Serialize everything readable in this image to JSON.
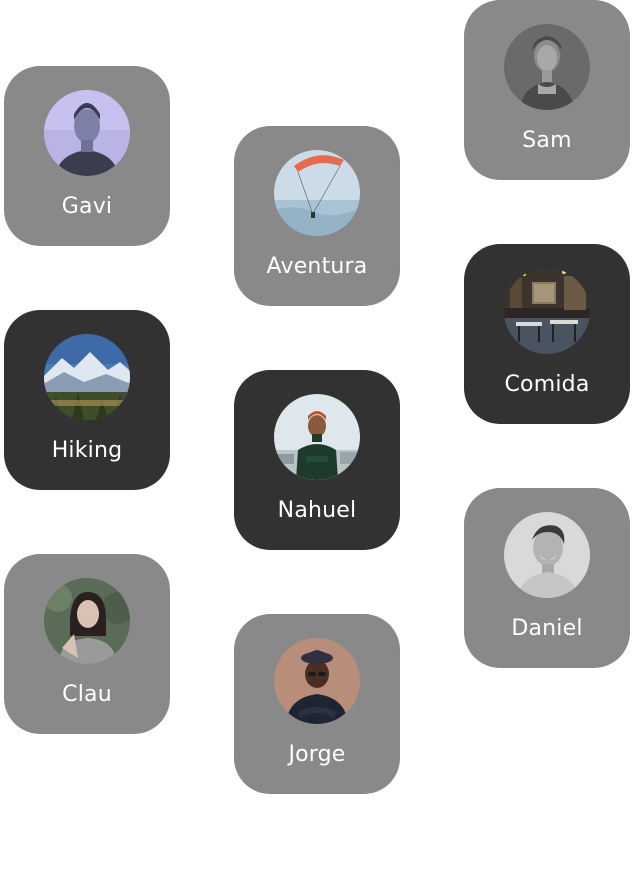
{
  "tiles": {
    "gavi": {
      "label": "Gavi",
      "avatar_icon": "person-portrait"
    },
    "hiking": {
      "label": "Hiking",
      "avatar_icon": "mountain-landscape"
    },
    "clau": {
      "label": "Clau",
      "avatar_icon": "person-portrait"
    },
    "aventura": {
      "label": "Aventura",
      "avatar_icon": "paraglider"
    },
    "nahuel": {
      "label": "Nahuel",
      "avatar_icon": "person-portrait"
    },
    "jorge": {
      "label": "Jorge",
      "avatar_icon": "person-portrait"
    },
    "sam": {
      "label": "Sam",
      "avatar_icon": "person-portrait"
    },
    "comida": {
      "label": "Comida",
      "avatar_icon": "restaurant-interior"
    },
    "daniel": {
      "label": "Daniel",
      "avatar_icon": "person-portrait"
    }
  },
  "colors": {
    "tile_light": "#898989",
    "tile_dark": "#323232",
    "label": "#ffffff"
  }
}
